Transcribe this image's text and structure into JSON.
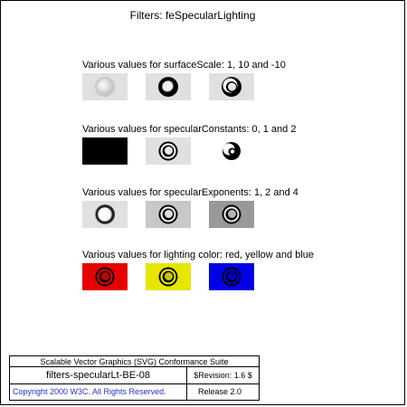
{
  "title": "Filters: feSpecularLighting",
  "sections": [
    {
      "heading": "Various values for surfaceScale: 1, 10 and -10",
      "tiles": [
        "surface-1",
        "surface-10",
        "surface-neg10"
      ]
    },
    {
      "heading": "Various values for specularConstants: 0, 1 and 2",
      "tiles": [
        "const-0",
        "const-1",
        "const-2"
      ]
    },
    {
      "heading": "Various values for specularExponents: 1, 2 and 4",
      "tiles": [
        "exp-1",
        "exp-2",
        "exp-4"
      ]
    },
    {
      "heading": "Various values for lighting color: red, yellow and blue",
      "tiles": [
        "color-red",
        "color-yellow",
        "color-blue"
      ]
    }
  ],
  "colors": {
    "red": "#e60000",
    "yellow": "#e6e600",
    "blue": "#0000e6",
    "link": "#2a2ad6"
  },
  "footer": {
    "suite": "Scalable Vector Graphics (SVG) Conformance Suite",
    "test_name": "filters-specularLt-BE-08",
    "revision": "$Revision: 1.6 $",
    "copyright": "Copyright 2000 W3C. All Rights Reserved.",
    "release": "Release 2.0"
  }
}
